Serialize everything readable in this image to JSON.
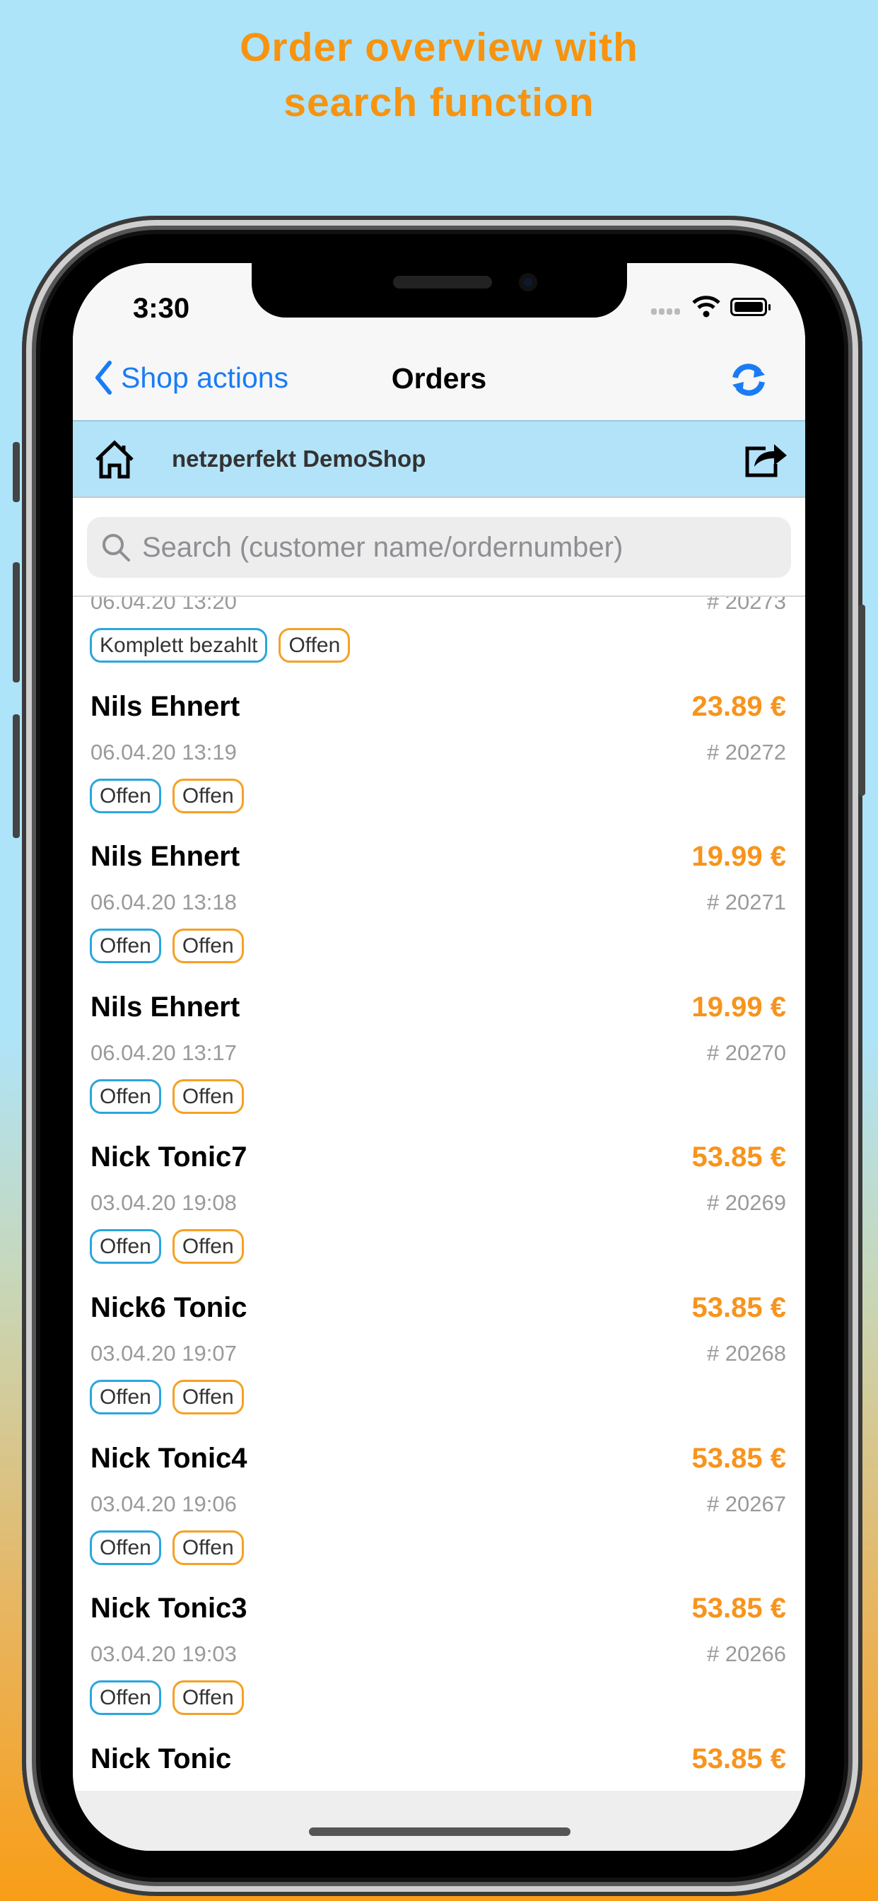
{
  "headline": {
    "line1": "Order overview with",
    "line2": "search function"
  },
  "status_bar": {
    "time": "3:30"
  },
  "navbar": {
    "back_label": "Shop actions",
    "title": "Orders",
    "refresh_icon": "refresh-icon"
  },
  "shop_bar": {
    "name": "netzperfekt DemoShop",
    "home_icon": "home-icon",
    "share_icon": "share-icon"
  },
  "search": {
    "placeholder": "Search (customer name/ordernumber)",
    "value": ""
  },
  "colors": {
    "accent": "#1a7cf5",
    "price": "#f7941d",
    "shop_bar": "#b3e3f9",
    "tag_payment": "#2ba6dd",
    "tag_status": "#f5a125"
  },
  "orders": [
    {
      "name": "",
      "price": "",
      "date": "06.04.20 13:20",
      "number": "# 20273",
      "payment": "Komplett bezahlt",
      "status": "Offen"
    },
    {
      "name": "Nils Ehnert",
      "price": "23.89 €",
      "date": "06.04.20 13:19",
      "number": "# 20272",
      "payment": "Offen",
      "status": "Offen"
    },
    {
      "name": "Nils Ehnert",
      "price": "19.99 €",
      "date": "06.04.20 13:18",
      "number": "# 20271",
      "payment": "Offen",
      "status": "Offen"
    },
    {
      "name": "Nils Ehnert",
      "price": "19.99 €",
      "date": "06.04.20 13:17",
      "number": "# 20270",
      "payment": "Offen",
      "status": "Offen"
    },
    {
      "name": "Nick Tonic7",
      "price": "53.85 €",
      "date": "03.04.20 19:08",
      "number": "# 20269",
      "payment": "Offen",
      "status": "Offen"
    },
    {
      "name": "Nick6 Tonic",
      "price": "53.85 €",
      "date": "03.04.20 19:07",
      "number": "# 20268",
      "payment": "Offen",
      "status": "Offen"
    },
    {
      "name": "Nick Tonic4",
      "price": "53.85 €",
      "date": "03.04.20 19:06",
      "number": "# 20267",
      "payment": "Offen",
      "status": "Offen"
    },
    {
      "name": "Nick Tonic3",
      "price": "53.85 €",
      "date": "03.04.20 19:03",
      "number": "# 20266",
      "payment": "Offen",
      "status": "Offen"
    },
    {
      "name": "Nick Tonic",
      "price": "53.85 €",
      "date": "",
      "number": "",
      "payment": "",
      "status": ""
    }
  ]
}
